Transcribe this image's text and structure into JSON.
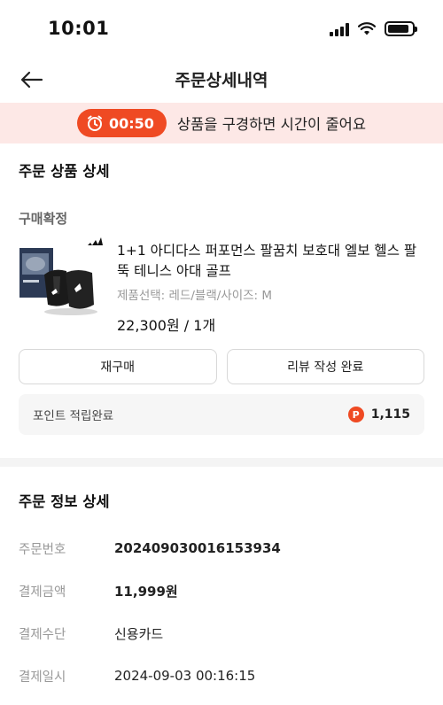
{
  "status_bar": {
    "time": "10:01",
    "battery_level": 0.9
  },
  "nav": {
    "title": "주문상세내역"
  },
  "timer_banner": {
    "time": "00:50",
    "message": "상품을 구경하면 시간이 줄어요",
    "accent_color": "#ef4a23",
    "background_color": "#fde8e6"
  },
  "product_section": {
    "title": "주문 상품 상세",
    "order_status": "구매확정",
    "product": {
      "name": "1+1 아디다스 퍼포먼스 팔꿈치 보호대 엘보 헬스 팔뚝 테니스 아대 골프",
      "option": "제품선택: 레드/블랙/사이즈: M",
      "price_qty": "22,300원 / 1개",
      "image_icon": "elbow-brace-product-icon",
      "brand_icon": "adidas-logo-icon"
    },
    "buttons": {
      "rebuy": "재구매",
      "review": "리뷰 작성 완료"
    },
    "points": {
      "label": "포인트 적립완료",
      "badge": "P",
      "amount": "1,115"
    }
  },
  "order_info": {
    "title": "주문 정보 상세",
    "rows": [
      {
        "label": "주문번호",
        "value": "20240903001615​3934"
      },
      {
        "label": "결제금액",
        "value": "11,999원"
      },
      {
        "label": "결제수단",
        "value": "신용카드"
      },
      {
        "label": "결제일시",
        "value": "2024-09-03 00:16:15"
      }
    ]
  }
}
